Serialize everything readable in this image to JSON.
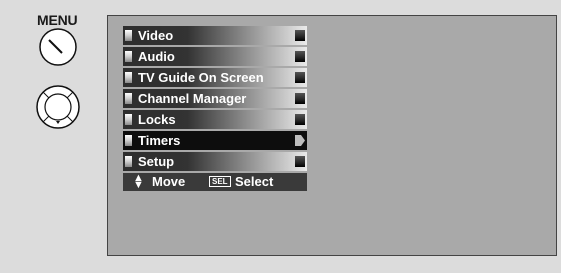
{
  "remote": {
    "menu_label": "MENU"
  },
  "menu": {
    "items": [
      {
        "label": "Video"
      },
      {
        "label": "Audio"
      },
      {
        "label": "TV Guide On Screen"
      },
      {
        "label": "Channel Manager"
      },
      {
        "label": "Locks"
      },
      {
        "label": "Timers",
        "selected": true
      },
      {
        "label": "Setup"
      }
    ],
    "selected_item": "Timers"
  },
  "nav_hint": {
    "move_label": "Move",
    "sel_badge": "SEL",
    "select_label": "Select",
    "move_icon": "up-down-arrows-icon"
  },
  "colors": {
    "page_bg": "#dcdcdc",
    "screen_bg": "#a9a9a9",
    "item_dark": "#2d2d2d",
    "item_light": "#eaeaea",
    "selected_bg": "#0d0d0d",
    "text": "#ffffff"
  }
}
